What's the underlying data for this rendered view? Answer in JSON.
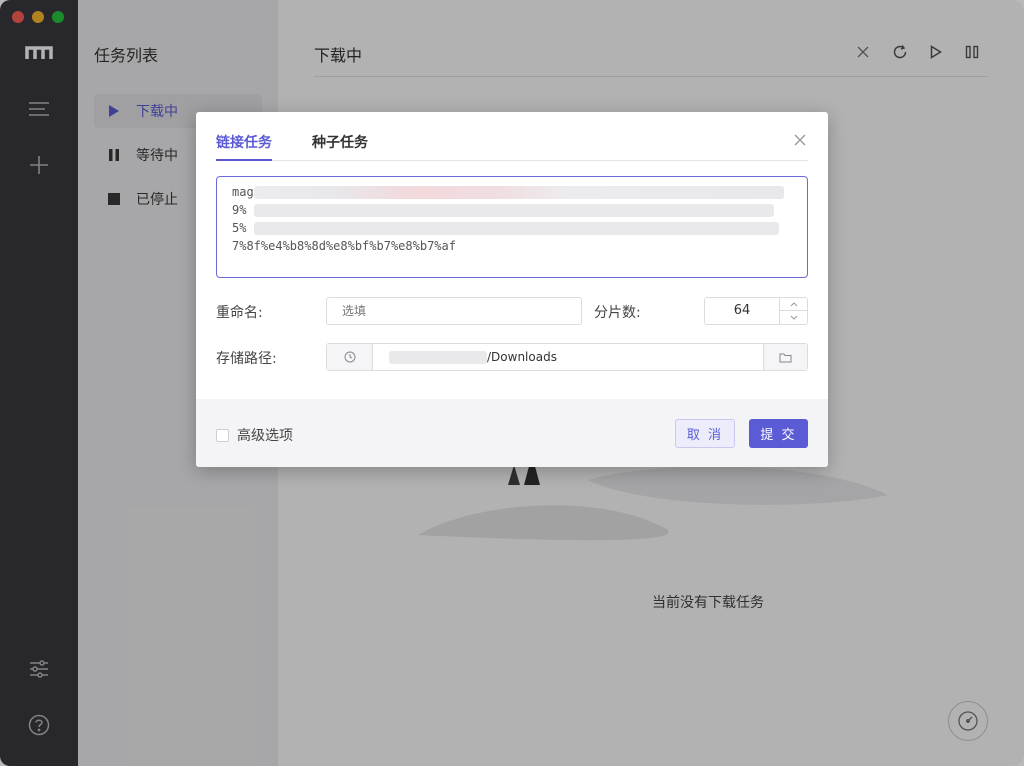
{
  "sidebar": {
    "panel_title": "任务列表",
    "items": [
      {
        "label": "下载中",
        "icon": "play-icon",
        "active": true
      },
      {
        "label": "等待中",
        "icon": "pause-icon",
        "active": false
      },
      {
        "label": "已停止",
        "icon": "stop-icon",
        "active": false
      }
    ]
  },
  "main": {
    "title": "下载中",
    "toolbar_icons": [
      "close-icon",
      "refresh-icon",
      "play-icon",
      "pause-icon"
    ],
    "empty_text": "当前没有下载任务"
  },
  "dialog": {
    "tabs": [
      {
        "label": "链接任务",
        "active": true
      },
      {
        "label": "种子任务",
        "active": false
      }
    ],
    "url_lines": [
      "mag",
      "9%",
      "5%",
      "7%8f%e4%b8%8d%e8%bf%b7%e8%b7%af"
    ],
    "rename_label": "重命名:",
    "rename_placeholder": "选填",
    "split_label": "分片数:",
    "split_value": "64",
    "path_label": "存储路径:",
    "path_suffix": "/Downloads",
    "advanced_label": "高级选项",
    "cancel_label": "取 消",
    "submit_label": "提 交"
  },
  "colors": {
    "accent": "#5b5bd6",
    "rail": "#3a3a3f"
  }
}
